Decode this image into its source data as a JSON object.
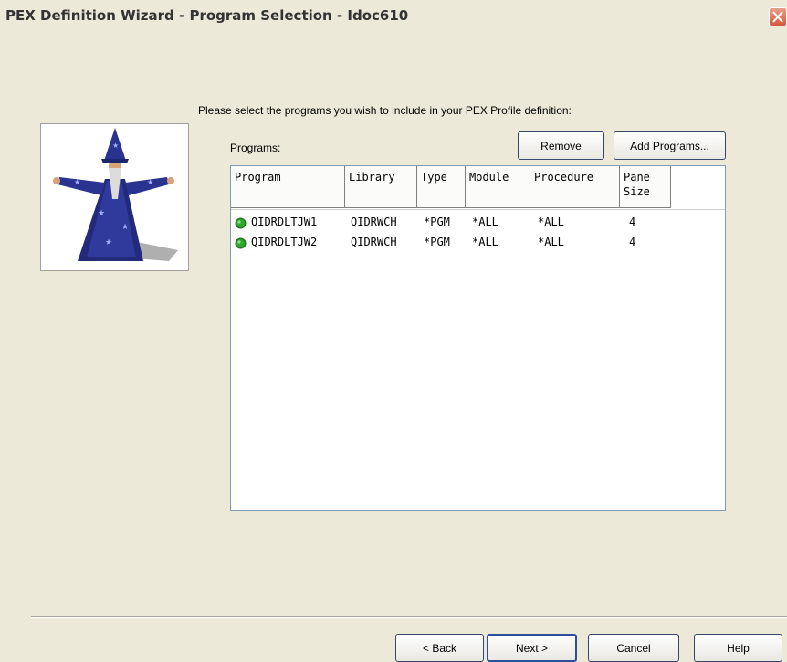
{
  "window": {
    "title": "PEX Definition Wizard - Program Selection - Idoc610"
  },
  "instruction": "Please select the programs you wish to include in your PEX Profile definition:",
  "programs_label": "Programs:",
  "buttons": {
    "remove": "Remove",
    "add_programs": "Add Programs...",
    "back": "< Back",
    "next": "Next >",
    "cancel": "Cancel",
    "help": "Help"
  },
  "table": {
    "columns": [
      "Program",
      "Library",
      "Type",
      "Module",
      "Procedure",
      "Pane\nSize"
    ],
    "rows": [
      {
        "program": "QIDRDLTJW1",
        "library": "QIDRWCH",
        "type": "*PGM",
        "module": "*ALL",
        "procedure": "*ALL",
        "pane_size": "4"
      },
      {
        "program": "QIDRDLTJW2",
        "library": "QIDRWCH",
        "type": "*PGM",
        "module": "*ALL",
        "procedure": "*ALL",
        "pane_size": "4"
      }
    ]
  },
  "icons": {
    "row_status": "green-gear-icon",
    "close": "close-icon",
    "wizard": "wizard-image"
  },
  "colors": {
    "status_green": "#2fa82f",
    "close_red": "#d4593b"
  }
}
